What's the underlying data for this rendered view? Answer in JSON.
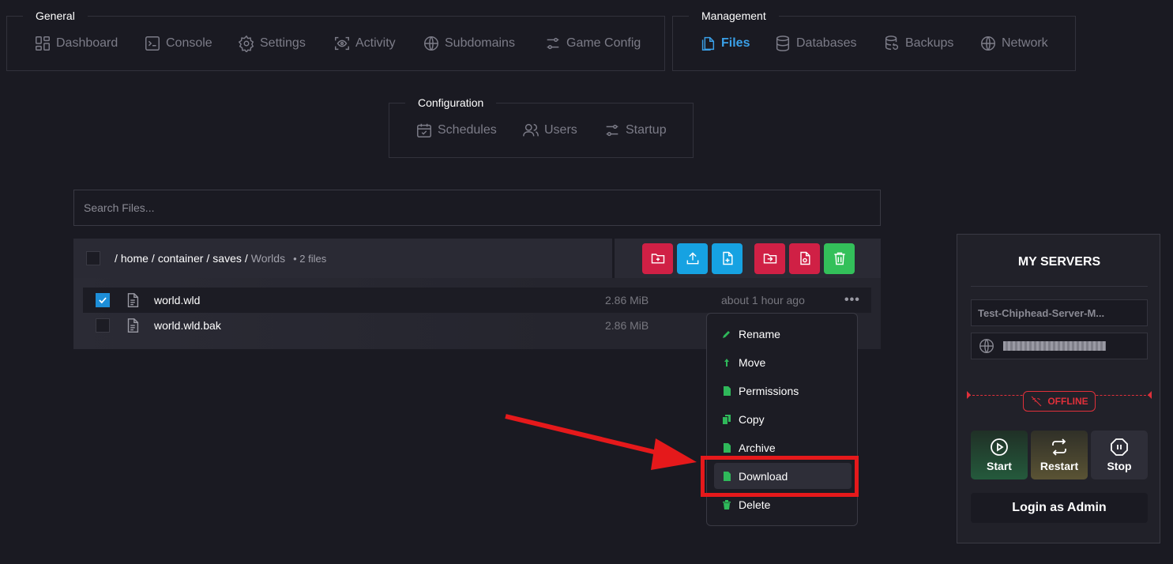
{
  "nav": {
    "general": {
      "legend": "General",
      "items": [
        {
          "label": "Dashboard",
          "icon": "dashboard-icon"
        },
        {
          "label": "Console",
          "icon": "terminal-icon"
        },
        {
          "label": "Settings",
          "icon": "gear-icon"
        },
        {
          "label": "Activity",
          "icon": "eye-icon"
        },
        {
          "label": "Subdomains",
          "icon": "globe-icon"
        },
        {
          "label": "Game Config",
          "icon": "sliders-icon"
        }
      ]
    },
    "management": {
      "legend": "Management",
      "items": [
        {
          "label": "Files",
          "icon": "files-icon",
          "active": true
        },
        {
          "label": "Databases",
          "icon": "database-icon"
        },
        {
          "label": "Backups",
          "icon": "backup-icon"
        },
        {
          "label": "Network",
          "icon": "globe-icon"
        }
      ]
    },
    "configuration": {
      "legend": "Configuration",
      "items": [
        {
          "label": "Schedules",
          "icon": "calendar-icon"
        },
        {
          "label": "Users",
          "icon": "users-icon"
        },
        {
          "label": "Startup",
          "icon": "sliders-icon"
        }
      ]
    }
  },
  "search": {
    "placeholder": "Search Files..."
  },
  "breadcrumb": {
    "root": "/",
    "segments": [
      "home",
      "container",
      "saves"
    ],
    "current": "Worlds",
    "count": "• 2 files"
  },
  "files": [
    {
      "name": "world.wld",
      "size": "2.86 MiB",
      "modified": "about 1 hour ago",
      "selected": true,
      "menu": "•••"
    },
    {
      "name": "world.wld.bak",
      "size": "2.86 MiB",
      "modified": "",
      "selected": false,
      "menu": ""
    }
  ],
  "context_menu": {
    "items": [
      "Rename",
      "Move",
      "Permissions",
      "Copy",
      "Archive",
      "Download",
      "Delete"
    ],
    "highlighted": "Download"
  },
  "server_panel": {
    "title": "MY SERVERS",
    "server_name": "Test-Chiphead-Server-M...",
    "status": "OFFLINE",
    "buttons": {
      "start": "Start",
      "restart": "Restart",
      "stop": "Stop"
    },
    "login": "Login as Admin"
  },
  "colors": {
    "background": "#1a1a22",
    "accent_blue": "#3aa0e8",
    "danger_red": "#d02045",
    "success_green": "#33c05a",
    "annotation_red": "#e5191b"
  }
}
